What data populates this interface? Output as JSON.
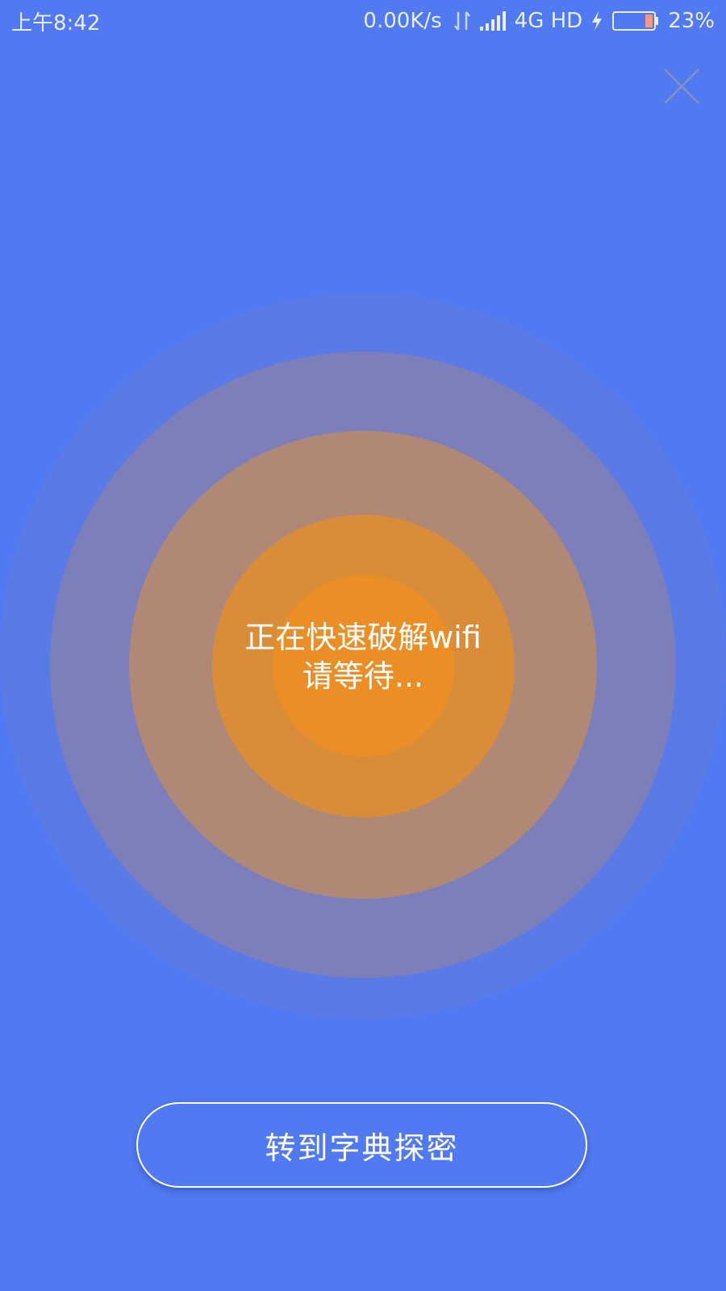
{
  "status_bar": {
    "time": "上午8:42",
    "net_speed": "0.00K/s",
    "network": "4G HD",
    "battery": "23%",
    "icons": [
      "updown-icon",
      "signal-icon",
      "bolt-icon",
      "battery-icon"
    ]
  },
  "close": {
    "icon": "close-icon"
  },
  "radar": {
    "line1": "正在快速破解wifi",
    "line2": "请等待..."
  },
  "actions": {
    "dict_label": "转到字典探密"
  },
  "colors": {
    "background": "#5179f1",
    "accent_orange": "#ea8e25",
    "text": "#ffffff"
  }
}
